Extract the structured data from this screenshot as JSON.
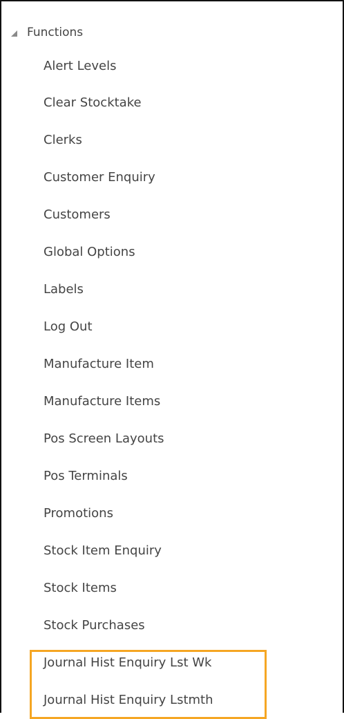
{
  "tree": {
    "header": {
      "label": "Functions",
      "icon": "triangle-expanded-icon"
    },
    "items": [
      {
        "label": "Alert Levels"
      },
      {
        "label": "Clear Stocktake"
      },
      {
        "label": "Clerks"
      },
      {
        "label": "Customer Enquiry"
      },
      {
        "label": "Customers"
      },
      {
        "label": "Global Options"
      },
      {
        "label": "Labels"
      },
      {
        "label": "Log Out"
      },
      {
        "label": "Manufacture Item"
      },
      {
        "label": "Manufacture Items"
      },
      {
        "label": "Pos Screen Layouts"
      },
      {
        "label": "Pos Terminals"
      },
      {
        "label": "Promotions"
      },
      {
        "label": "Stock Item Enquiry"
      },
      {
        "label": "Stock Items"
      },
      {
        "label": "Stock Purchases"
      },
      {
        "label": "Journal Hist Enquiry Lst Wk"
      },
      {
        "label": "Journal Hist Enquiry Lstmth"
      }
    ]
  },
  "colors": {
    "text": "#444444",
    "highlight": "#f5a623",
    "border": "#111111"
  }
}
